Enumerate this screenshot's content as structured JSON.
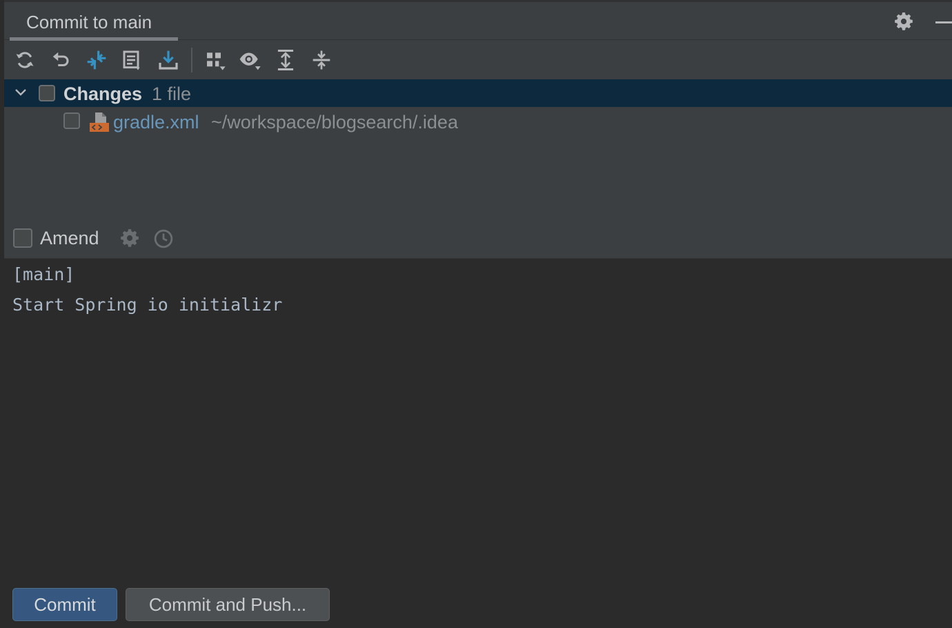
{
  "header": {
    "tab_title": "Commit to main"
  },
  "toolbar": {
    "buttons": [
      {
        "name": "refresh-icon"
      },
      {
        "name": "rollback-icon"
      },
      {
        "name": "show-diff-icon"
      },
      {
        "name": "changelist-icon"
      },
      {
        "name": "download-icon"
      },
      {
        "name": "group-by-icon"
      },
      {
        "name": "view-options-icon"
      },
      {
        "name": "expand-all-icon"
      },
      {
        "name": "collapse-all-icon"
      }
    ]
  },
  "changes": {
    "label": "Changes",
    "count": "1 file",
    "files": [
      {
        "name": "gradle.xml",
        "path": "~/workspace/blogsearch/.idea"
      }
    ]
  },
  "amend": {
    "label": "Amend"
  },
  "commit_message": {
    "line1": "[main]",
    "line2": "Start Spring io initializr"
  },
  "actions": {
    "commit_label": "Commit",
    "commit_push_label": "Commit and Push..."
  },
  "colors": {
    "accent_blue": "#3592c4",
    "file_name": "#6897bb",
    "selection_bg": "#0d293e",
    "primary_button": "#365880"
  }
}
